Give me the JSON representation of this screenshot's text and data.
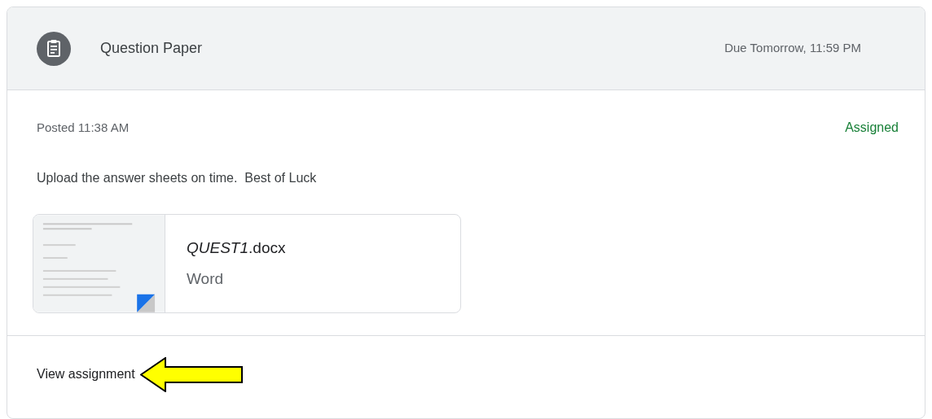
{
  "header": {
    "title": "Question Paper",
    "due": "Due Tomorrow, 11:59 PM"
  },
  "posted": "Posted 11:38 AM",
  "status": "Assigned",
  "description": "Upload the answer sheets on time.  Best of Luck",
  "attachment": {
    "name": "*QUEST1*.docx",
    "type": "Word"
  },
  "link": "View assignment"
}
